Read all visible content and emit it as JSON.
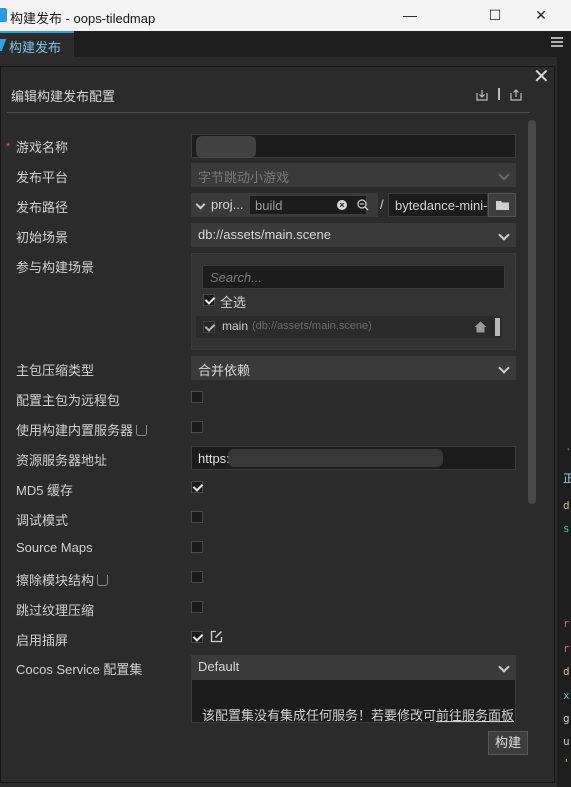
{
  "window": {
    "title": "构建发布 - oops-tiledmap",
    "minimize": "—",
    "maximize": "☐",
    "close": "✕"
  },
  "tab": {
    "label": "构建发布"
  },
  "panel": {
    "header": "编辑构建发布配置",
    "close": "✕"
  },
  "fields": {
    "game_name": {
      "label": "游戏名称",
      "value": ""
    },
    "platform": {
      "label": "发布平台",
      "value": "字节跳动小游戏"
    },
    "path": {
      "label": "发布路径",
      "prefix": "proj...",
      "input": "build",
      "slash": "/",
      "folder": "bytedance-mini-g"
    },
    "start_scene": {
      "label": "初始场景",
      "value": "db://assets/main.scene"
    },
    "scenes": {
      "label": "参与构建场景",
      "search_placeholder": "Search...",
      "select_all": "全选",
      "item_name": "main",
      "item_path": "(db://assets/main.scene)"
    },
    "compression": {
      "label": "主包压缩类型",
      "value": "合并依赖"
    },
    "remote": {
      "label": "配置主包为远程包",
      "checked": false
    },
    "builtin_server": {
      "label": "使用构建内置服务器",
      "checked": false
    },
    "server_url": {
      "label": "资源服务器地址",
      "value": "https:"
    },
    "md5": {
      "label": "MD5 缓存",
      "checked": true
    },
    "debug": {
      "label": "调试模式",
      "checked": false
    },
    "sourcemaps": {
      "label": "Source Maps",
      "checked": false
    },
    "erase_modules": {
      "label": "擦除模块结构",
      "checked": false
    },
    "skip_texture": {
      "label": "跳过纹理压缩",
      "checked": false
    },
    "splash": {
      "label": "启用插屏",
      "checked": true
    },
    "cocos_service": {
      "label": "Cocos Service 配置集",
      "value": "Default"
    }
  },
  "notice": {
    "text": "该配置集没有集成任何服务！若要修改可",
    "link": "前往服务面板"
  },
  "build_button": "构建",
  "colors": {
    "accent": "#2f9fd9",
    "background": "#2b2b2b",
    "input": "#1c1c1c",
    "select": "#3a3a3a"
  }
}
